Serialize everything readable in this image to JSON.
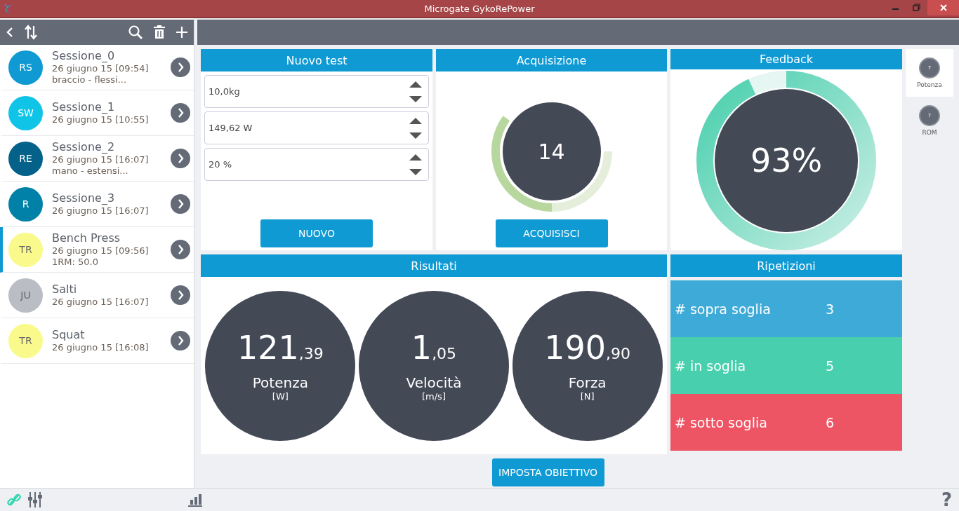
{
  "window": {
    "title": "Microgate GykoRePower"
  },
  "sessions": [
    {
      "initials": "RS",
      "color": "#0f9ad4",
      "name": "Sessione_0",
      "date": "26 giugno 15 [09:54]",
      "note": "braccio - flessi...",
      "selected": false
    },
    {
      "initials": "SW",
      "color": "#10c4e8",
      "name": "Sessione_1",
      "date": "26 giugno 15 [10:55]",
      "selected": false
    },
    {
      "initials": "RE",
      "color": "#03618a",
      "name": "Sessione_2",
      "date": "26 giugno 15 [16:07]",
      "note": "mano - estensi...",
      "selected": false
    },
    {
      "initials": "R",
      "color": "#0281a8",
      "name": "Sessione_3",
      "date": "26 giugno 15 [16:07]",
      "selected": false
    },
    {
      "initials": "TR",
      "color": "#fafa8c",
      "name": "Bench Press",
      "date": "26 giugno 15 [09:56]",
      "note": "1RM: 50.0",
      "selected": true
    },
    {
      "initials": "JU",
      "color": "#babec4",
      "name": "Salti",
      "date": "26 giugno 15 [16:07]",
      "selected": false
    },
    {
      "initials": "TR",
      "color": "#fafa8c",
      "name": "Squat",
      "date": "26 giugno 15 [16:08]",
      "selected": false
    }
  ],
  "new_test": {
    "title": "Nuovo test",
    "fields": [
      "10,0kg",
      "149,62 W",
      "20 %"
    ],
    "button": "NUOVO"
  },
  "acquisition": {
    "title": "Acquisizione",
    "count": "14",
    "level": 0.35,
    "button": "ACQUISISCI"
  },
  "feedback": {
    "title": "Feedback",
    "value": "93%",
    "level": 0.93
  },
  "dials": [
    {
      "value": "7",
      "label": "Potenza",
      "selected": true
    },
    {
      "value": "7",
      "label": "ROM",
      "selected": false
    }
  ],
  "results": {
    "title": "Risultati",
    "items": [
      {
        "integer": "121",
        "decimal": ",39",
        "label": "Potenza",
        "unit": "[W]"
      },
      {
        "integer": "1",
        "decimal": ",05",
        "label": "Velocità",
        "unit": "[m/s]"
      },
      {
        "integer": "190",
        "decimal": ",90",
        "label": "Forza",
        "unit": "[N]"
      }
    ]
  },
  "repetitions": {
    "title": "Ripetizioni",
    "items": [
      {
        "label": "# sopra soglia",
        "count": "3",
        "color": "#3eaad8"
      },
      {
        "label": "# in soglia",
        "count": "5",
        "color": "#48cfad"
      },
      {
        "label": "# sotto soglia",
        "count": "6",
        "color": "#ed5565"
      }
    ]
  },
  "goal_button": "IMPOSTA OBIETTIVO",
  "help": "?"
}
